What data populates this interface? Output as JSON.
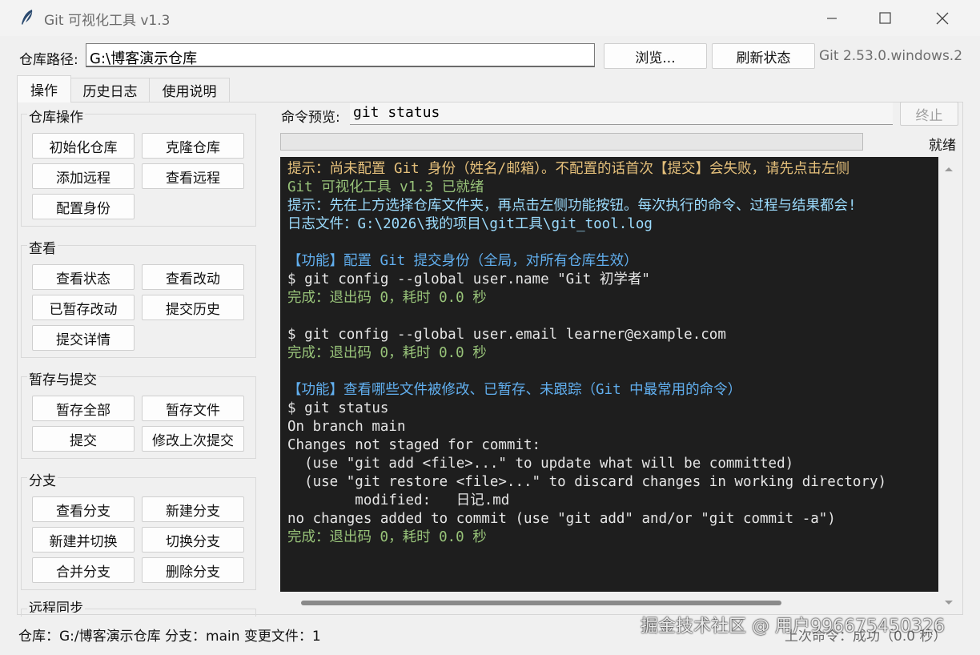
{
  "window": {
    "title": "Git 可视化工具 v1.3"
  },
  "toolbar": {
    "path_label": "仓库路径:",
    "path_value": "G:\\博客演示仓库",
    "browse_label": "浏览...",
    "refresh_label": "刷新状态",
    "git_version": "Git 2.53.0.windows.2"
  },
  "tabs": [
    {
      "label": "操作"
    },
    {
      "label": "历史日志"
    },
    {
      "label": "使用说明"
    }
  ],
  "groups": {
    "repo": {
      "title": "仓库操作",
      "buttons": [
        "初始化仓库",
        "克隆仓库",
        "添加远程",
        "查看远程",
        "配置身份"
      ]
    },
    "view": {
      "title": "查看",
      "buttons": [
        "查看状态",
        "查看改动",
        "已暂存改动",
        "提交历史",
        "提交详情"
      ]
    },
    "stage": {
      "title": "暂存与提交",
      "buttons": [
        "暂存全部",
        "暂存文件",
        "提交",
        "修改上次提交"
      ]
    },
    "branch": {
      "title": "分支",
      "buttons": [
        "查看分支",
        "新建分支",
        "新建并切换",
        "切换分支",
        "合并分支",
        "删除分支"
      ]
    },
    "remote": {
      "title": "远程同步"
    }
  },
  "command": {
    "label": "命令预览:",
    "value": "git status",
    "stop_label": "终止",
    "progress": 0,
    "state": "就绪"
  },
  "console_lines": [
    {
      "text": "提示：尚未配置 Git 身份（姓名/邮箱）。不配置的话首次【提交】会失败，请先点击左侧",
      "color": "yellow"
    },
    {
      "text": "Git 可视化工具 v1.3 已就绪",
      "color": "green"
    },
    {
      "text": "提示：先在上方选择仓库文件夹，再点击左侧功能按钮。每次执行的命令、过程与结果都会!",
      "color": "blue"
    },
    {
      "text": "日志文件：G:\\2026\\我的项目\\git工具\\git_tool.log",
      "color": "blue"
    },
    {
      "text": "",
      "color": "white"
    },
    {
      "text": "【功能】配置 Git 提交身份（全局，对所有仓库生效）",
      "color": "section"
    },
    {
      "text": "$ git config --global user.name \"Git 初学者\"",
      "color": "white"
    },
    {
      "text": "完成：退出码 0，耗时 0.0 秒",
      "color": "green"
    },
    {
      "text": "",
      "color": "white"
    },
    {
      "text": "$ git config --global user.email learner@example.com",
      "color": "white"
    },
    {
      "text": "完成：退出码 0，耗时 0.0 秒",
      "color": "green"
    },
    {
      "text": "",
      "color": "white"
    },
    {
      "text": "【功能】查看哪些文件被修改、已暂存、未跟踪（Git 中最常用的命令）",
      "color": "section"
    },
    {
      "text": "$ git status",
      "color": "white"
    },
    {
      "text": "On branch main",
      "color": "white"
    },
    {
      "text": "Changes not staged for commit:",
      "color": "white"
    },
    {
      "text": "  (use \"git add <file>...\" to update what will be committed)",
      "color": "white"
    },
    {
      "text": "  (use \"git restore <file>...\" to discard changes in working directory)",
      "color": "white"
    },
    {
      "text": "        modified:   日记.md",
      "color": "white"
    },
    {
      "text": "no changes added to commit (use \"git add\" and/or \"git commit -a\")",
      "color": "white"
    },
    {
      "text": "完成：退出码 0，耗时 0.0 秒",
      "color": "green"
    }
  ],
  "status": {
    "left": "仓库：G:/博客演示仓库    分支：main    变更文件：1",
    "right": "上次命令：成功（0.0 秒）"
  },
  "watermark": "掘金技术社区 @ 用户996675450326"
}
